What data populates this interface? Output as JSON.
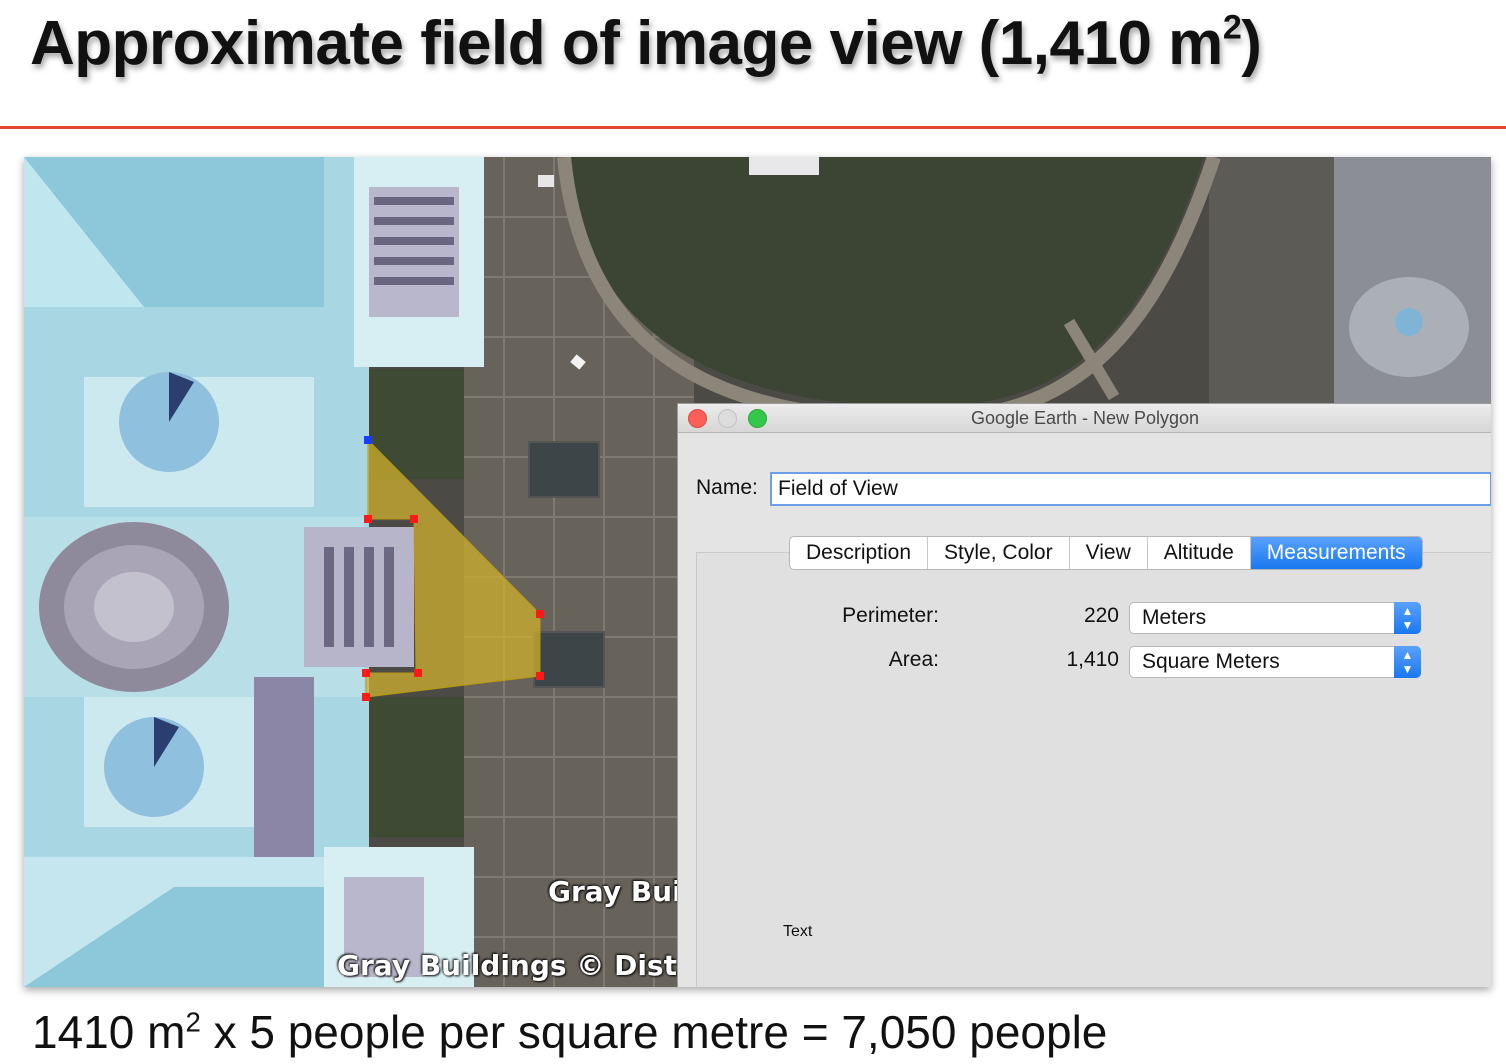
{
  "slide": {
    "title_prefix": "Approximate field of image view (1,410 m",
    "title_sup": "2",
    "title_suffix": ")",
    "caption_prefix": "1410 m",
    "caption_sup": "2",
    "caption_suffix": " x 5 people per square metre = 7,050 people",
    "rule_color": "#e8462a"
  },
  "map": {
    "label_building": "Gray Bui",
    "label_attribution": "Gray Buildings © Distr"
  },
  "dialog": {
    "window_title": "Google Earth - New Polygon",
    "name_label": "Name:",
    "name_value": "Field of View",
    "tabs": [
      {
        "label": "Description",
        "active": false
      },
      {
        "label": "Style, Color",
        "active": false
      },
      {
        "label": "View",
        "active": false
      },
      {
        "label": "Altitude",
        "active": false
      },
      {
        "label": "Measurements",
        "active": true
      }
    ],
    "measurements": {
      "perimeter_label": "Perimeter:",
      "perimeter_value": "220",
      "perimeter_unit": "Meters",
      "area_label": "Area:",
      "area_value": "1,410",
      "area_unit": "Square Meters"
    },
    "text_placeholder": "Text",
    "accent_color": "#1a78f0"
  }
}
